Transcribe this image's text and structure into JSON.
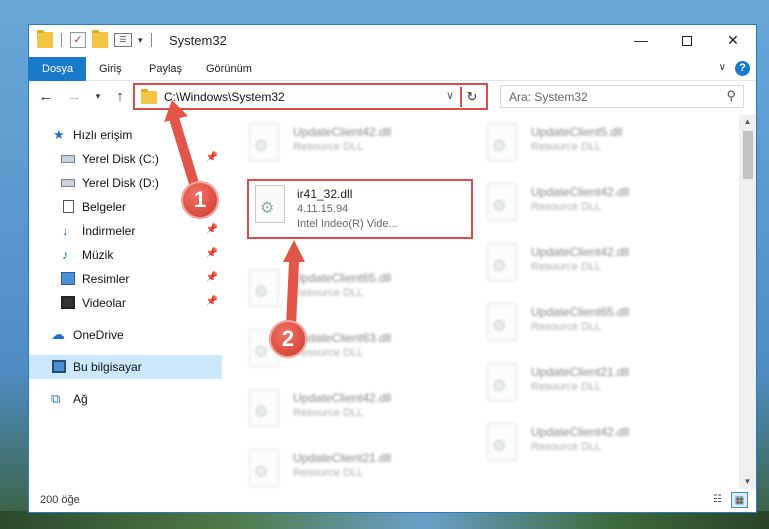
{
  "window": {
    "title": "System32"
  },
  "ribbon": {
    "tabs": [
      "Dosya",
      "Giriş",
      "Paylaş",
      "Görünüm"
    ],
    "help": "?"
  },
  "controls": {
    "minimize": "—",
    "close": "✕"
  },
  "address": {
    "path": "C:\\Windows\\System32",
    "search_placeholder": "Ara: System32"
  },
  "sidebar": {
    "items": [
      {
        "label": "Hızlı erişim"
      },
      {
        "label": "Yerel Disk (C:)"
      },
      {
        "label": "Yerel Disk (D:)"
      },
      {
        "label": "Belgeler"
      },
      {
        "label": "İndirmeler"
      },
      {
        "label": "Müzik"
      },
      {
        "label": "Resimler"
      },
      {
        "label": "Videolar"
      },
      {
        "label": "OneDrive"
      },
      {
        "label": "Bu bilgisayar"
      },
      {
        "label": "Ağ"
      }
    ]
  },
  "files": {
    "left": [
      {
        "name": "UpdateClient42.dll",
        "desc": "Resource DLL"
      },
      {
        "name": "ir41_32.dll",
        "version": "4.11.15.94",
        "desc": "Intel Indeo(R) Vide..."
      },
      {
        "name": "UpdateClient65.dll",
        "desc": "Resource DLL"
      },
      {
        "name": "UpdateClient63.dll",
        "desc": "Resource DLL"
      },
      {
        "name": "UpdateClient42.dll",
        "desc": "Resource DLL"
      },
      {
        "name": "UpdateClient21.dll",
        "desc": "Resource DLL"
      }
    ],
    "right": [
      {
        "name": "UpdateClient5.dll",
        "desc": "Resource DLL"
      },
      {
        "name": "UpdateClient42.dll",
        "desc": "Resource DLL"
      },
      {
        "name": "UpdateClient42.dll",
        "desc": "Resource DLL"
      },
      {
        "name": "UpdateClient65.dll",
        "desc": "Resource DLL"
      },
      {
        "name": "UpdateClient21.dll",
        "desc": "Resource DLL"
      },
      {
        "name": "UpdateClient42.dll",
        "desc": "Resource DLL"
      }
    ]
  },
  "status": {
    "count": "200 öğe"
  },
  "callouts": {
    "one": "1",
    "two": "2"
  },
  "colors": {
    "accent": "#1979ca",
    "highlight": "#e04a4a",
    "callout": "#d7473b"
  }
}
